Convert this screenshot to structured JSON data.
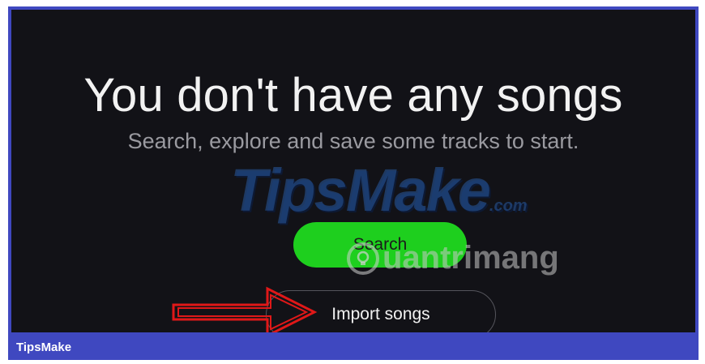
{
  "empty_state": {
    "title": "You don't have any songs",
    "subtitle": "Search, explore and save some tracks to start."
  },
  "actions": {
    "search_label": "Search",
    "import_label": "Import songs"
  },
  "watermarks": {
    "tipsmake": "TipsMake",
    "tipsmake_suffix": ".com",
    "quantrimang": "uantrimang"
  },
  "footer": {
    "brand": "TipsMake"
  },
  "colors": {
    "background": "#121217",
    "accent_green": "#1ecf1e",
    "frame_blue": "#3f48c0",
    "annotation_red": "#e01818"
  }
}
